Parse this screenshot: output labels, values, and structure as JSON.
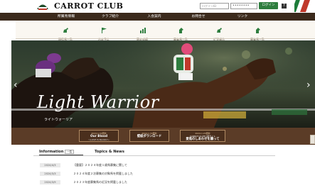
{
  "header": {
    "brand": "CARROT CLUB",
    "login_id_placeholder": "ログインID",
    "password_mask": "••••••••",
    "login_button": "ログイン",
    "help_label": "?"
  },
  "nav": [
    "所属馬情報",
    "クラブ紹介",
    "入会案内",
    "お問合せ",
    "リンク"
  ],
  "subnav": [
    {
      "label": "現役馬一覧",
      "icon": "horse-icon"
    },
    {
      "label": "出走予定",
      "icon": "flag-icon"
    },
    {
      "label": "競走成績",
      "icon": "chart-icon"
    },
    {
      "label": "募集馬一覧",
      "icon": "horse-head-icon"
    },
    {
      "label": "近況報告",
      "icon": "horse-icon"
    },
    {
      "label": "募集馬一覧",
      "icon": "horse-head-icon"
    }
  ],
  "hero": {
    "title": "Light Warrior",
    "subtitle": "ライトウォーリア",
    "prev_arrow": "‹",
    "next_arrow": "›"
  },
  "strip": [
    {
      "date": "2024.1.30更新",
      "title": "Our Blood",
      "sub": "～LOVE IS BLOOD～"
    },
    {
      "date": "2024.1.30更新",
      "title": "壁紙ダウンロード",
      "sub": ""
    },
    {
      "date": "2024.1.20更新",
      "title": "CARROT CLUB公認サイト",
      "sub": "愛馬のしあわせを願って"
    }
  ],
  "news": {
    "tab_info": "Information",
    "tab_info_badge": "一覧",
    "tab_topics": "Topics & News",
    "items": [
      {
        "date": "2024/4/3",
        "title": "【重要】２０２４年度１歳馬募集に関して"
      },
      {
        "date": "2024/3/3",
        "title": "２０２４年度２次募集の対象馬を掲載しました"
      },
      {
        "date": "2024/3/9",
        "title": "２０２３年度募集馬の近況を掲載しました"
      }
    ]
  },
  "colors": {
    "nav_bg": "#3b2a1c",
    "accent_green": "#2e7d3e",
    "strip_bg": "#5b3c27"
  }
}
